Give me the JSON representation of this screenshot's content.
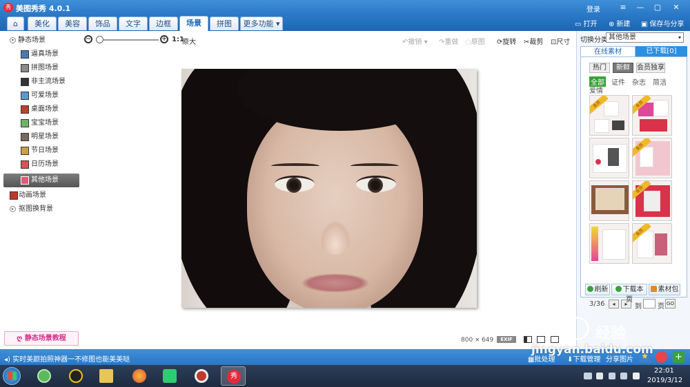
{
  "app": {
    "logo": "秀",
    "title": "美图秀秀 4.0.1",
    "login": "登录"
  },
  "window_controls": {
    "menu": "≡",
    "minimize": "—",
    "maximize": "▢",
    "close": "✕"
  },
  "tabs": [
    "美化",
    "美容",
    "饰品",
    "文字",
    "边框",
    "场景",
    "拼图"
  ],
  "more_label": "更多功能",
  "active_tab": "场景",
  "top_actions": {
    "open": "打开",
    "new": "新建",
    "save": "保存与分享"
  },
  "toolbar": {
    "ratio": "1:1",
    "original": "原大",
    "undo": "撤销",
    "redo": "重做",
    "restore": "原图",
    "rotate": "旋转",
    "crop": "裁剪",
    "size": "尺寸"
  },
  "sidebar": {
    "root": "静态场景",
    "items": [
      "逼真场景",
      "拼图场景",
      "非主流场景",
      "可爱场景",
      "桌面场景",
      "宝宝场景",
      "明星场景",
      "节日场景",
      "日历场景",
      "其他场景"
    ],
    "selected": "其他场景",
    "animated": "动画场景",
    "cutout": "抠图换背景",
    "tutorial": "静态场景教程"
  },
  "image_info": {
    "width": "800",
    "times": "×",
    "height": "649",
    "exif": "EXIF"
  },
  "right_panel": {
    "category_label": "切换分类",
    "category_value": "其他场景",
    "tab_online": "在线素材",
    "tab_downloaded": "已下载[0]",
    "subtabs": [
      "热门",
      "新鲜",
      "会员独享"
    ],
    "active_subtab": "新鲜",
    "filters": [
      "全部",
      "证件",
      "杂志",
      "简洁",
      "爱情"
    ],
    "active_filter": "全部",
    "vip_label": "会员",
    "page_indicator": "3/36",
    "page_to": "到",
    "page_unit": "页",
    "go": "GO",
    "refresh": "刷新",
    "download_page": "下载本页",
    "material_pack": "素材包"
  },
  "statusbar": {
    "tip": "实时美颜拍照神器一不修图也能美美哒",
    "batch": "批处理",
    "download_manage": "下载管理",
    "share": "分享图片"
  },
  "taskbar": {
    "time": "22:01",
    "date": "2019/3/12",
    "active_app_label": "秀"
  },
  "watermark": {
    "cn": "经验",
    "en": "jingyan.baidu.com"
  },
  "colors": {
    "title_blue": "#2a78c6",
    "panel_blue": "#2d8fe0",
    "tutorial_pink": "#d6338b",
    "filter_green": "#3aa13a"
  }
}
